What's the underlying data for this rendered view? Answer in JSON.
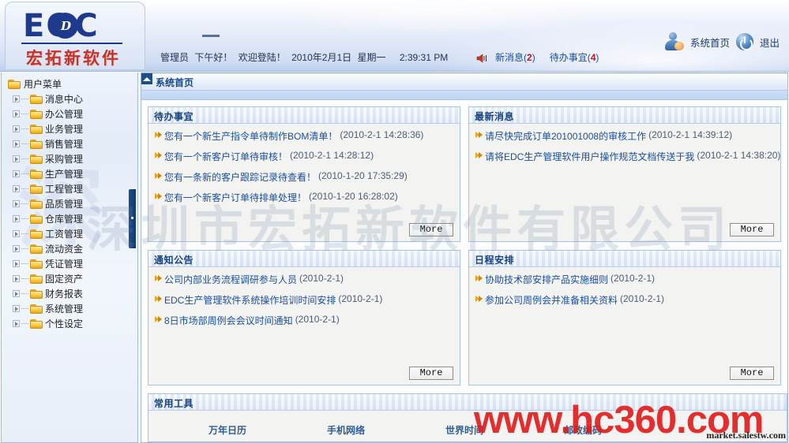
{
  "header": {
    "logo": {
      "main": "EOC",
      "dot_letter": "D",
      "subtitle": "宏拓新软件"
    },
    "greeting": {
      "user": "管理员",
      "salutation": "下午好！",
      "welcome": "欢迎登陆！",
      "date": "2010年2月1日",
      "weekday": "星期一",
      "time": "2:39:31 PM"
    },
    "notifications": {
      "speaker_icon": "speaker-icon",
      "new_message_label": "新消息(",
      "new_message_count": "2",
      "new_message_suffix": ")",
      "todo_label": "待办事宜(",
      "todo_count": "4",
      "todo_suffix": ")"
    },
    "actions": {
      "home_label": "系统首页",
      "home_icon": "user-home-icon",
      "logout_label": "退出",
      "logout_icon": "power-icon"
    }
  },
  "sidebar": {
    "root": {
      "label": "用户菜单",
      "icon": "folder-icon"
    },
    "items": [
      {
        "label": "消息中心",
        "icon": "folder-icon"
      },
      {
        "label": "办公管理",
        "icon": "folder-icon"
      },
      {
        "label": "业务管理",
        "icon": "folder-icon"
      },
      {
        "label": "销售管理",
        "icon": "folder-icon"
      },
      {
        "label": "采购管理",
        "icon": "folder-icon"
      },
      {
        "label": "生产管理",
        "icon": "folder-icon"
      },
      {
        "label": "工程管理",
        "icon": "folder-icon"
      },
      {
        "label": "品质管理",
        "icon": "folder-icon"
      },
      {
        "label": "仓库管理",
        "icon": "folder-icon"
      },
      {
        "label": "工资管理",
        "icon": "folder-icon"
      },
      {
        "label": "流动资金",
        "icon": "folder-icon"
      },
      {
        "label": "凭证管理",
        "icon": "folder-icon"
      },
      {
        "label": "固定资产",
        "icon": "folder-icon"
      },
      {
        "label": "财务报表",
        "icon": "folder-icon"
      },
      {
        "label": "系统管理",
        "icon": "folder-icon"
      },
      {
        "label": "个性设定",
        "icon": "folder-icon"
      }
    ]
  },
  "main": {
    "title": "系统首页",
    "more_label": "More",
    "panels": {
      "todo": {
        "title": "待办事宜",
        "items": [
          {
            "text": "您有一个新生产指令单待制作BOM清单！",
            "time": "(2010-2-1 14:28:36)"
          },
          {
            "text": "您有一个新客户订单待审核！",
            "time": "(2010-2-1 14:28:12)"
          },
          {
            "text": "您有一条新的客户跟踪记录待查看！",
            "time": "(2010-1-20 17:35:29)"
          },
          {
            "text": "您有一个新客户订单待排单处理！",
            "time": "(2010-1-20 16:28:02)"
          }
        ]
      },
      "news": {
        "title": "最新消息",
        "items": [
          {
            "text": "请尽快完成订单201001008的审核工作",
            "time": "(2010-2-1 14:39:12)"
          },
          {
            "text": "请将EDC生产管理软件用户操作规范文档传送于我",
            "time": "(2010-2-1 14:38:20)"
          }
        ]
      },
      "notice": {
        "title": "通知公告",
        "items": [
          {
            "text": "公司内部业务流程调研参与人员",
            "time": "(2010-2-1)"
          },
          {
            "text": "EDC生产管理软件系统操作培训时间安排",
            "time": "(2010-2-1)"
          },
          {
            "text": "8日市场部周例会会议时间通知",
            "time": "(2010-2-1)"
          }
        ]
      },
      "schedule": {
        "title": "日程安排",
        "items": [
          {
            "text": "协助技术部安排产品实施细则",
            "time": "(2010-2-1)"
          },
          {
            "text": "参加公司周例会并准备相关资料",
            "time": "(2010-2-1)"
          }
        ]
      },
      "tools": {
        "title": "常用工具",
        "items": [
          "万年日历",
          "手机网络",
          "世界时间",
          "邮政编码"
        ]
      }
    }
  },
  "watermarks": {
    "company": "深圳市宏拓新软件有限公司",
    "site_red": "www.hc360.com",
    "site_small": "market.salestw.com"
  },
  "colors": {
    "brand_blue": "#1e3a8c",
    "brand_red": "#c1332b",
    "link_blue": "#1a4f9e",
    "count_red": "#c0132b",
    "panel_border": "#a9c3e6"
  }
}
